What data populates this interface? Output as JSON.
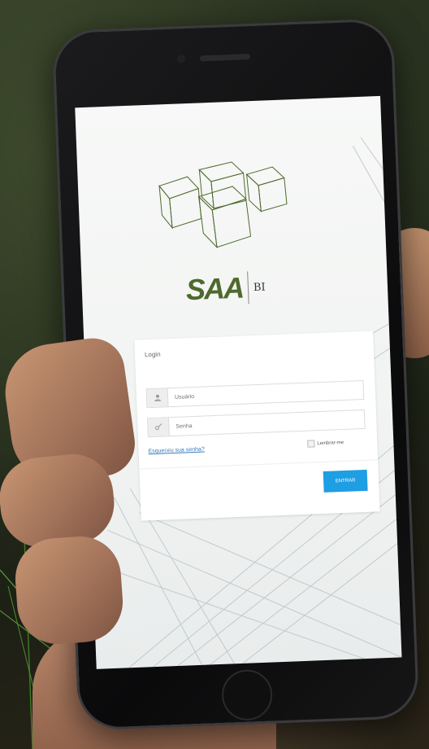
{
  "brand": {
    "name": "SAA",
    "suffix": "BI",
    "accent_color": "#4e6a2c"
  },
  "login": {
    "title": "Login",
    "username_placeholder": "Usuário",
    "password_placeholder": "Senha",
    "forgot_link": "Esqueceu sua senha?",
    "remember_label": "Lembrar-me",
    "submit_label": "ENTRAR",
    "button_color": "#1e9ee3"
  },
  "icons": {
    "logo": "isometric-cubes-icon",
    "user_field": "user-icon",
    "password_field": "key-icon"
  }
}
